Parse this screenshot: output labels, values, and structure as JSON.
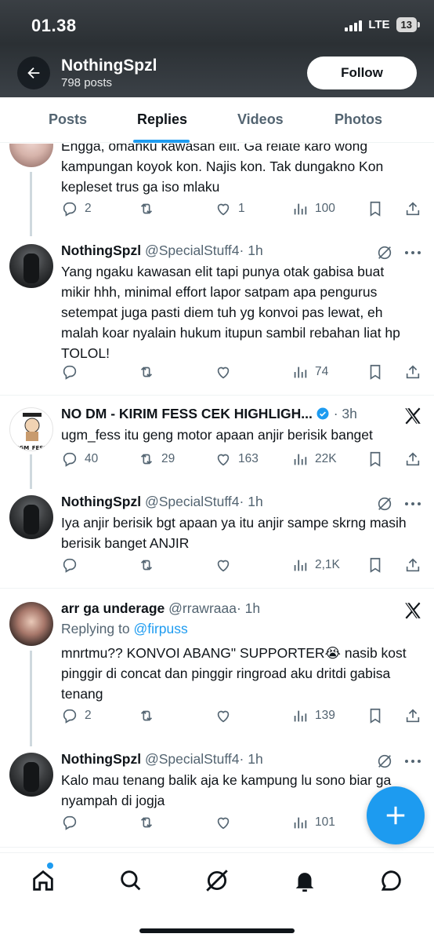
{
  "status_bar": {
    "time": "01.38",
    "network": "LTE",
    "battery": "13"
  },
  "header": {
    "profile_name": "NothingSpzl",
    "post_count": "798 posts",
    "follow_label": "Follow"
  },
  "tabs": [
    {
      "label": "Posts"
    },
    {
      "label": "Replies"
    },
    {
      "label": "Videos"
    },
    {
      "label": "Photos"
    }
  ],
  "posts": [
    {
      "name": "",
      "handle": "",
      "time": "",
      "text": "Engga, omahku kawasan elit. Ga relate karo wong kampungan koyok kon. Najis kon. Tak dungakno Kon kepleset trus ga iso mlaku",
      "replies": "2",
      "reposts": "",
      "likes": "1",
      "views": "100"
    },
    {
      "name": "NothingSpzl",
      "handle": "@SpecialStuff4",
      "time": "· 1h",
      "text": "Yang ngaku kawasan elit tapi punya otak gabisa buat mikir hhh, minimal effort lapor satpam apa pengurus  setempat juga pasti diem tuh yg konvoi pas lewat, eh malah koar nyalain hukum itupun sambil rebahan liat hp TOLOL!",
      "replies": "",
      "reposts": "",
      "likes": "",
      "views": "74"
    },
    {
      "name": "NO DM - KIRIM FESS CEK HIGHLIGH...",
      "handle": "",
      "time": "· 3h",
      "text": "ugm_fess itu geng motor apaan anjir berisik banget",
      "replies": "40",
      "reposts": "29",
      "likes": "163",
      "views": "22K",
      "avatar_text": "IGM_FESS"
    },
    {
      "name": "NothingSpzl",
      "handle": "@SpecialStuff4",
      "time": "· 1h",
      "text": "Iya anjir berisik bgt apaan ya itu anjir sampe skrng masih berisik banget ANJIR",
      "replies": "",
      "reposts": "",
      "likes": "",
      "views": "2,1K"
    },
    {
      "name": "arr ga underage",
      "handle": "@rrawraaa",
      "time": "· 1h",
      "replying_prefix": "Replying to",
      "replying_to": "@firpuss",
      "text": "mnrtmu?? KONVOI ABANG\" SUPPORTER😭 nasib kost pinggir di concat dan pinggir ringroad aku dritdi gabisa tenang",
      "replies": "2",
      "reposts": "",
      "likes": "",
      "views": "139"
    },
    {
      "name": "NothingSpzl",
      "handle": "@SpecialStuff4",
      "time": "· 1h",
      "text": "Kalo mau tenang balik aja ke kampung lu sono biar ga nyampah di jogja",
      "replies": "",
      "reposts": "",
      "likes": "",
      "views": "101"
    }
  ],
  "colors": {
    "accent": "#1d9bf0",
    "text": "#0f1419",
    "secondary": "#536471"
  },
  "nav_icons": [
    "home-icon",
    "search-icon",
    "grok-icon",
    "notifications-icon",
    "messages-icon"
  ]
}
